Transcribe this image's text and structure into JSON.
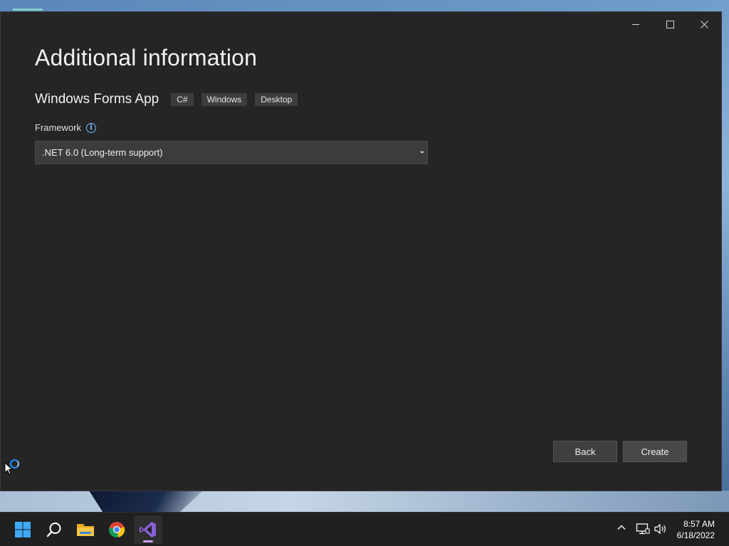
{
  "window": {
    "title": "Additional information",
    "project_name": "Windows Forms App",
    "tags": [
      "C#",
      "Windows",
      "Desktop"
    ],
    "framework_label": "Framework",
    "framework_selected": ".NET 6.0 (Long-term support)",
    "back_label": "Back",
    "create_label": "Create",
    "controls": [
      "minimize-icon",
      "maximize-icon",
      "close-icon"
    ]
  },
  "taskbar": {
    "icons": [
      "windows-start-icon",
      "search-icon",
      "file-explorer-icon",
      "chrome-icon",
      "visual-studio-icon"
    ],
    "active": "visual-studio-icon",
    "time": "8:57 AM",
    "date": "6/18/2022",
    "tray_icons": [
      "chevron-up-icon",
      "network-icon",
      "volume-icon"
    ]
  },
  "colors": {
    "window_bg": "#252526",
    "accent_vs": "#c9a2f0",
    "info": "#75beff"
  }
}
